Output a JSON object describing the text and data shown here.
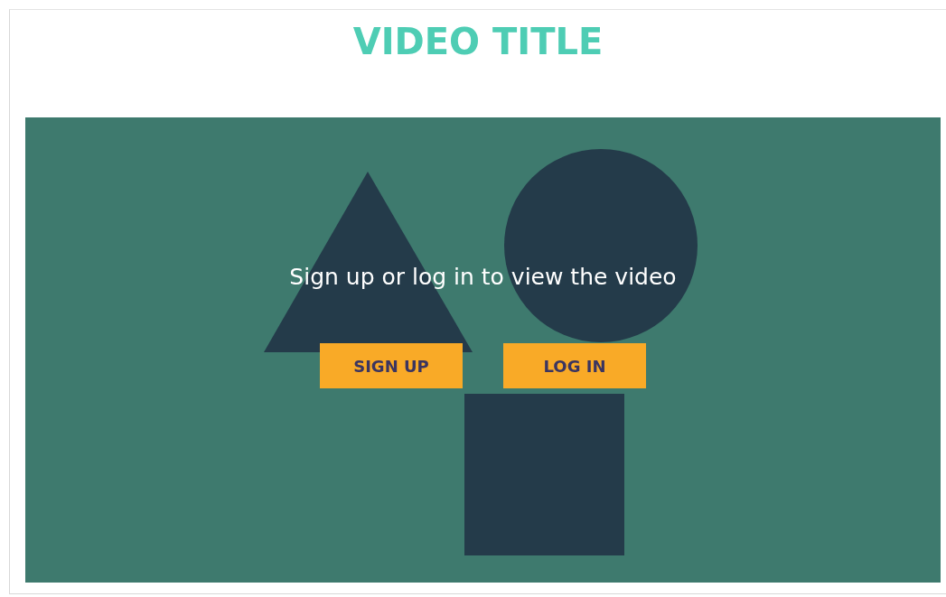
{
  "title": "VIDEO TITLE",
  "video": {
    "message": "Sign up or log in to view the video",
    "buttons": [
      {
        "label": "SIGN UP"
      },
      {
        "label": "LOG IN"
      }
    ]
  }
}
